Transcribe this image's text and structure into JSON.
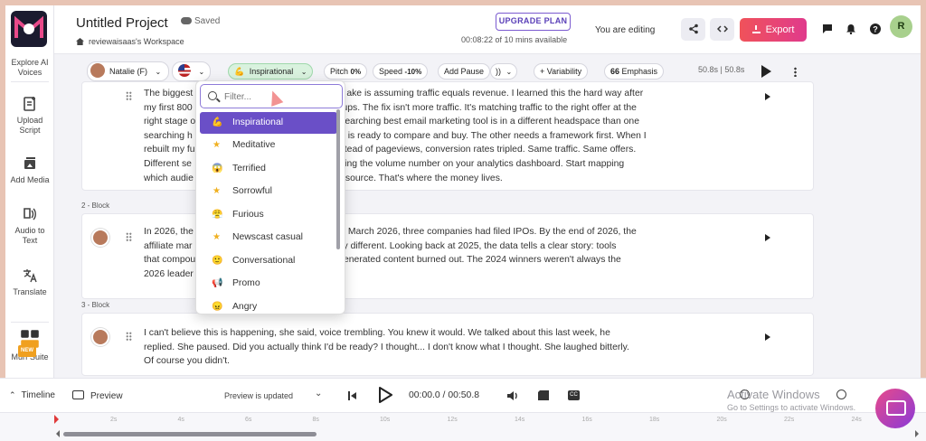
{
  "header": {
    "project_title": "Untitled Project",
    "saved_label": "Saved",
    "workspace": "reviewaisaas's Workspace",
    "upgrade_label": "UPGRADE PLAN",
    "time_available": "00:08:22 of 10 mins available",
    "editing_label": "You are editing",
    "export_label": "Export",
    "avatar_initial": "R"
  },
  "sidebar": {
    "items": [
      {
        "label": "Explore AI Voices"
      },
      {
        "label": "Upload Script"
      },
      {
        "label": "Add Media"
      },
      {
        "label": "Audio to Text"
      },
      {
        "label": "Translate"
      },
      {
        "label": "Murf Suite",
        "badge": "NEW"
      }
    ]
  },
  "toolbar": {
    "voice_name": "Natalie (F)",
    "style": "Inspirational",
    "pitch_label": "Pitch",
    "pitch_value": "0%",
    "speed_label": "Speed",
    "speed_value": "-10%",
    "add_pause": "Add Pause",
    "variability": "+ Variability",
    "emphasis": "Emphasis",
    "duration": "50.8s | 50.8s"
  },
  "blocks": [
    {
      "label": "",
      "text": "The biggest mistake is assuming traffic equals revenue. I learned this the hard way after my first 800 signups. The fix isn't more traffic. It's matching traffic to the right offer at the right stage. Someone searching best email marketing tool is in a different headspace than one searching how to... one is ready to compare and buy. The other needs a framework first. When I rebuilt my funnel instead of pageviews, conversion rates tripled. Same traffic. Same offers. Different sequencing the volume number on your analytics dashboard. Start mapping which audience source. That's where the money lives.",
      "lines": [
        {
          "left": "The biggest",
          "right": "ake is assuming traffic equals revenue. I learned this the hard way after"
        },
        {
          "left": "my first 800",
          "right": "nups. The fix isn't more traffic. It's matching traffic to the right offer at the"
        },
        {
          "left": "right stage o",
          "right": "searching best email marketing tool is in a different headspace than one"
        },
        {
          "left": "searching h",
          "right": "is ready to compare and buy. The other needs a framework first. When I"
        },
        {
          "left": "rebuilt my fu",
          "right": "stead of pageviews, conversion rates tripled. Same traffic. Same offers."
        },
        {
          "left": "Different se",
          "right": "zing the volume number on your analytics dashboard. Start mapping"
        },
        {
          "left": "which audie",
          "right": "source. That's where the money lives."
        }
      ]
    },
    {
      "label": "2 -  Block",
      "lines": [
        {
          "left": "In 2026, the",
          "right": "By March 2026, three companies had filed IPOs. By the end of 2026, the"
        },
        {
          "left": "affiliate mar",
          "right": "tely different. Looking back at 2025, the data tells a clear story: tools"
        },
        {
          "left": "that compou",
          "right": "generated content burned out. The 2024 winners weren't always the"
        },
        {
          "left": "2026 leader",
          "right": ""
        }
      ]
    },
    {
      "label": "3 -  Block",
      "lines": [
        {
          "left": "I can't believe this is happening, she said, voice trembling. You knew it would. We talked about this last week, he",
          "right": ""
        },
        {
          "left": "replied. She paused. Did you actually think I'd be ready? I thought... I don't know what I thought. She laughed bitterly.",
          "right": ""
        },
        {
          "left": "Of course you didn't.",
          "right": ""
        }
      ]
    }
  ],
  "dropdown": {
    "placeholder": "Filter...",
    "items": [
      {
        "label": "Inspirational",
        "icon": "flexed-biceps-icon",
        "glyph": "💪",
        "selected": true
      },
      {
        "label": "Meditative",
        "icon": "star-icon",
        "glyph": "★"
      },
      {
        "label": "Terrified",
        "icon": "scared-face-icon",
        "glyph": "😱"
      },
      {
        "label": "Sorrowful",
        "icon": "star-icon",
        "glyph": "★"
      },
      {
        "label": "Furious",
        "icon": "angry-face-icon",
        "glyph": "😤"
      },
      {
        "label": "Newscast casual",
        "icon": "star-icon",
        "glyph": "★"
      },
      {
        "label": "Conversational",
        "icon": "smiling-face-icon",
        "glyph": "🙂"
      },
      {
        "label": "Promo",
        "icon": "megaphone-icon",
        "glyph": "📢"
      },
      {
        "label": "Angry",
        "icon": "angry-face-icon",
        "glyph": "😠"
      }
    ]
  },
  "bottombar": {
    "timeline_label": "Timeline",
    "preview_label": "Preview",
    "preview_status": "Preview is updated",
    "time": "00:00.0 / 00:50.8",
    "ticks": [
      "2s",
      "4s",
      "6s",
      "8s",
      "10s",
      "12s",
      "14s",
      "16s",
      "18s",
      "20s",
      "22s",
      "24s"
    ],
    "watermark_title": "Activate Windows",
    "watermark_sub": "Go to Settings to activate Windows."
  },
  "colors": {
    "accent": "#6a4fc7",
    "export_start": "#f0525a",
    "export_end": "#e03a8c",
    "style_pill_bg": "#d9f2de"
  }
}
